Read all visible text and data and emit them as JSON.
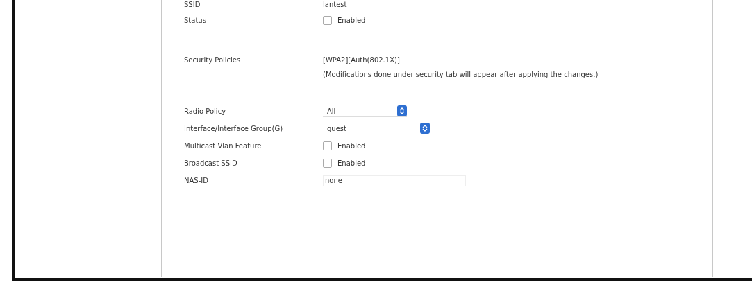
{
  "ssid": {
    "label": "SSID",
    "value": "lantest"
  },
  "status": {
    "label": "Status",
    "checked": false,
    "text": "Enabled"
  },
  "security": {
    "label": "Security Policies",
    "value": "[WPA2][Auth(802.1X)]",
    "note": "(Modifications done under security tab will appear after applying the changes.)"
  },
  "fields": [
    {
      "kind": "select",
      "label": "Radio Policy",
      "value": "All"
    },
    {
      "kind": "select",
      "label": "Interface/Interface Group(G)",
      "value": "guest"
    },
    {
      "kind": "checkbox",
      "label": "Multicast Vlan Feature",
      "checked": false,
      "text": "Enabled"
    },
    {
      "kind": "checkbox",
      "label": "Broadcast SSID",
      "checked": false,
      "text": "Enabled"
    },
    {
      "kind": "text",
      "label": "NAS-ID",
      "value": "none"
    }
  ]
}
